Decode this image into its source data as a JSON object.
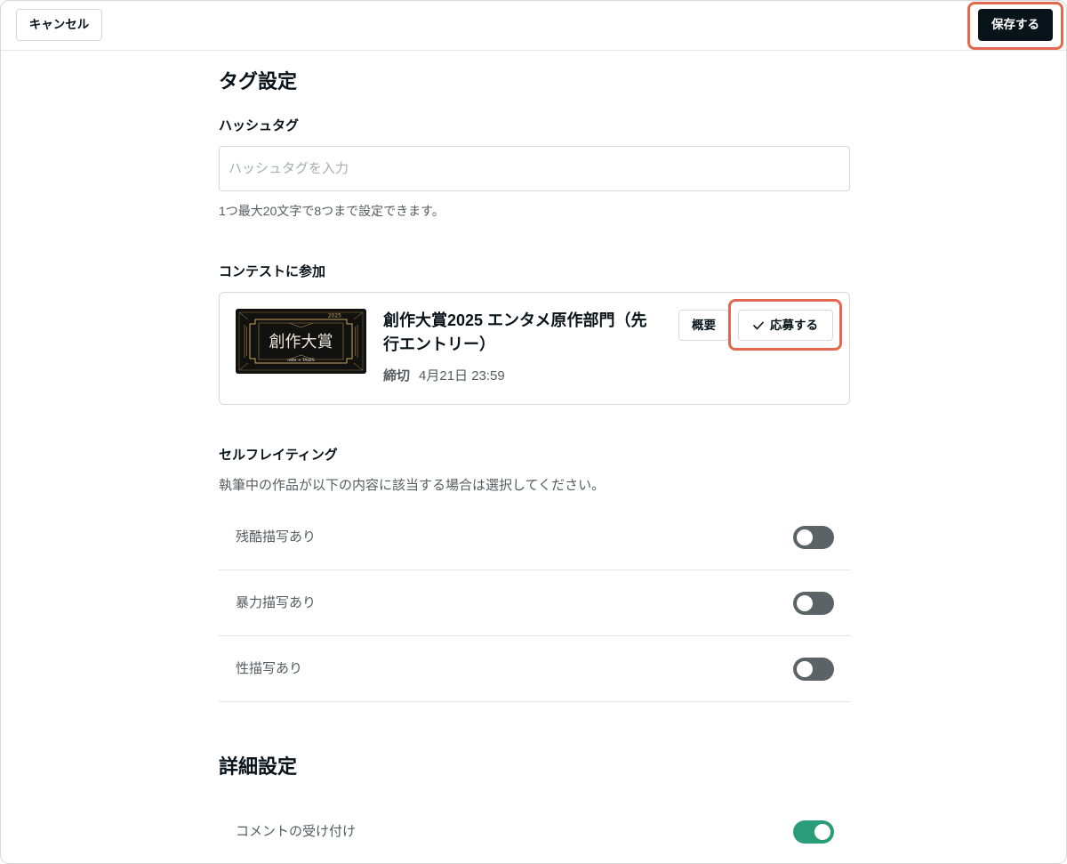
{
  "header": {
    "cancel_label": "キャンセル",
    "save_label": "保存する"
  },
  "tags": {
    "title": "タグ設定",
    "hashtag_label": "ハッシュタグ",
    "hashtag_placeholder": "ハッシュタグを入力",
    "hashtag_help": "1つ最大20文字で8つまで設定できます。"
  },
  "contest": {
    "label": "コンテストに参加",
    "thumbnail": {
      "year": "2025",
      "title": "創作大賞",
      "logo": "note × TALES"
    },
    "title": "創作大賞2025 エンタメ原作部門（先行エントリー）",
    "deadline_label": "締切",
    "deadline": "4月21日 23:59",
    "overview_label": "概要",
    "apply_label": "応募する",
    "apply_icon": "check-icon"
  },
  "rating": {
    "label": "セルフレイティング",
    "description": "執筆中の作品が以下の内容に該当する場合は選択してください。",
    "items": [
      {
        "label": "残酷描写あり",
        "checked": false
      },
      {
        "label": "暴力描写あり",
        "checked": false
      },
      {
        "label": "性描写あり",
        "checked": false
      }
    ]
  },
  "details": {
    "title": "詳細設定",
    "items": [
      {
        "label": "コメントの受け付け",
        "checked": true
      }
    ]
  },
  "colors": {
    "primary": "#08131a",
    "toggle_on": "#2a9d78",
    "toggle_off": "#5c6367",
    "highlight": "#e2694f",
    "thumbnail_gold": "#c9a45c"
  }
}
